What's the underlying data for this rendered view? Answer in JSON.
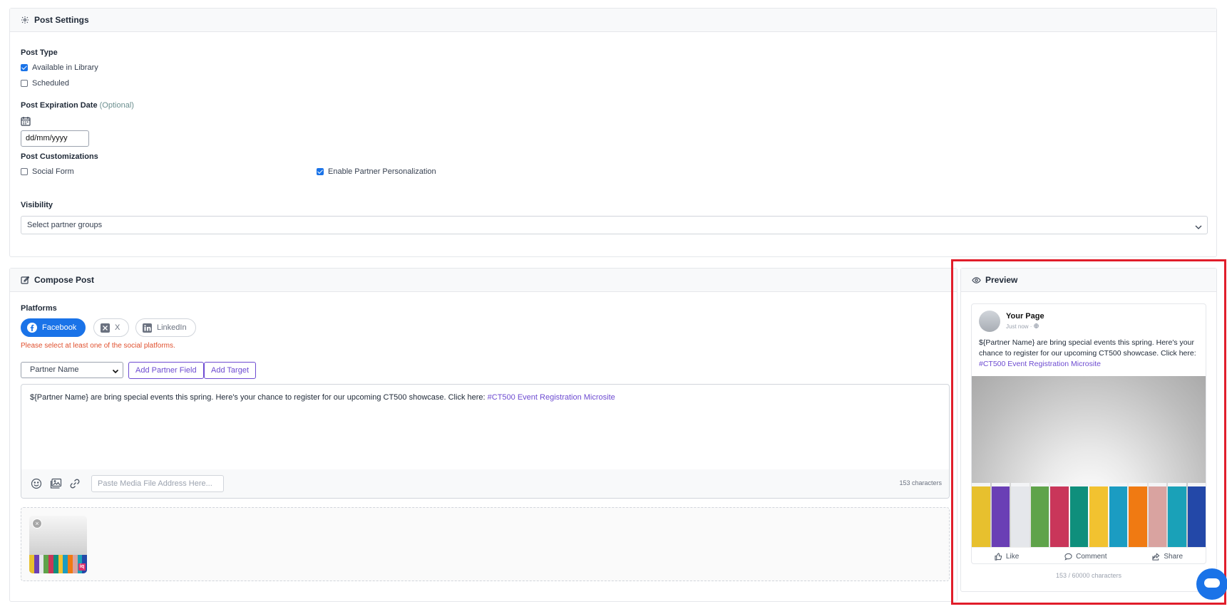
{
  "settings": {
    "title": "Post Settings",
    "post_type_label": "Post Type",
    "available_in_library": {
      "label": "Available in Library",
      "checked": true
    },
    "scheduled": {
      "label": "Scheduled",
      "checked": false
    },
    "expiration_label": "Post Expiration Date",
    "expiration_optional": "(Optional)",
    "expiration_value": "dd/mm/yyyy",
    "customizations_label": "Post Customizations",
    "social_form": {
      "label": "Social Form",
      "checked": false
    },
    "partner_personalization": {
      "label": "Enable Partner Personalization",
      "checked": true
    },
    "visibility_label": "Visibility",
    "visibility_placeholder": "Select partner groups"
  },
  "compose": {
    "title": "Compose Post",
    "platforms_label": "Platforms",
    "platforms": [
      {
        "label": "Facebook",
        "icon": "facebook-icon",
        "active": true
      },
      {
        "label": "X",
        "icon": "x-icon",
        "active": false
      },
      {
        "label": "LinkedIn",
        "icon": "linkedin-icon",
        "active": false
      }
    ],
    "error": "Please select at least one of the social platforms.",
    "partner_field_select": "Partner Name",
    "add_partner_field": "Add Partner Field",
    "add_target": "Add Target",
    "body_text": "${Partner Name} are bring special events this spring. Here's your chance to register for our upcoming CT500 showcase. Click here: ",
    "body_link": "#CT500 Event Registration Microsite",
    "media_placeholder": "Paste Media File Address Here...",
    "char_count": "153 characters",
    "thumb_close": "×",
    "thumb_badge": "iq"
  },
  "preview": {
    "title": "Preview",
    "page_name": "Your Page",
    "time": "Just now · ",
    "text": "${Partner Name} are bring special events this spring. Here's your chance to register for our upcoming CT500 showcase. Click here: ",
    "link": "#CT500 Event Registration Microsite",
    "like": "Like",
    "comment": "Comment",
    "share": "Share",
    "count": "153 / 60000 characters"
  },
  "colors": {
    "accent": "#1a73e8",
    "purple": "#6d4bd1",
    "error": "#e0502e",
    "highlight": "#e11d2a"
  },
  "book_colors": [
    "#e7c02e",
    "#6a3fb5",
    "#e5e7eb",
    "#5fa34a",
    "#c9365a",
    "#0f8f7c",
    "#f2c230",
    "#1b9cc2",
    "#f07a12",
    "#d9a3a0",
    "#1aa1b8",
    "#2348a8"
  ]
}
